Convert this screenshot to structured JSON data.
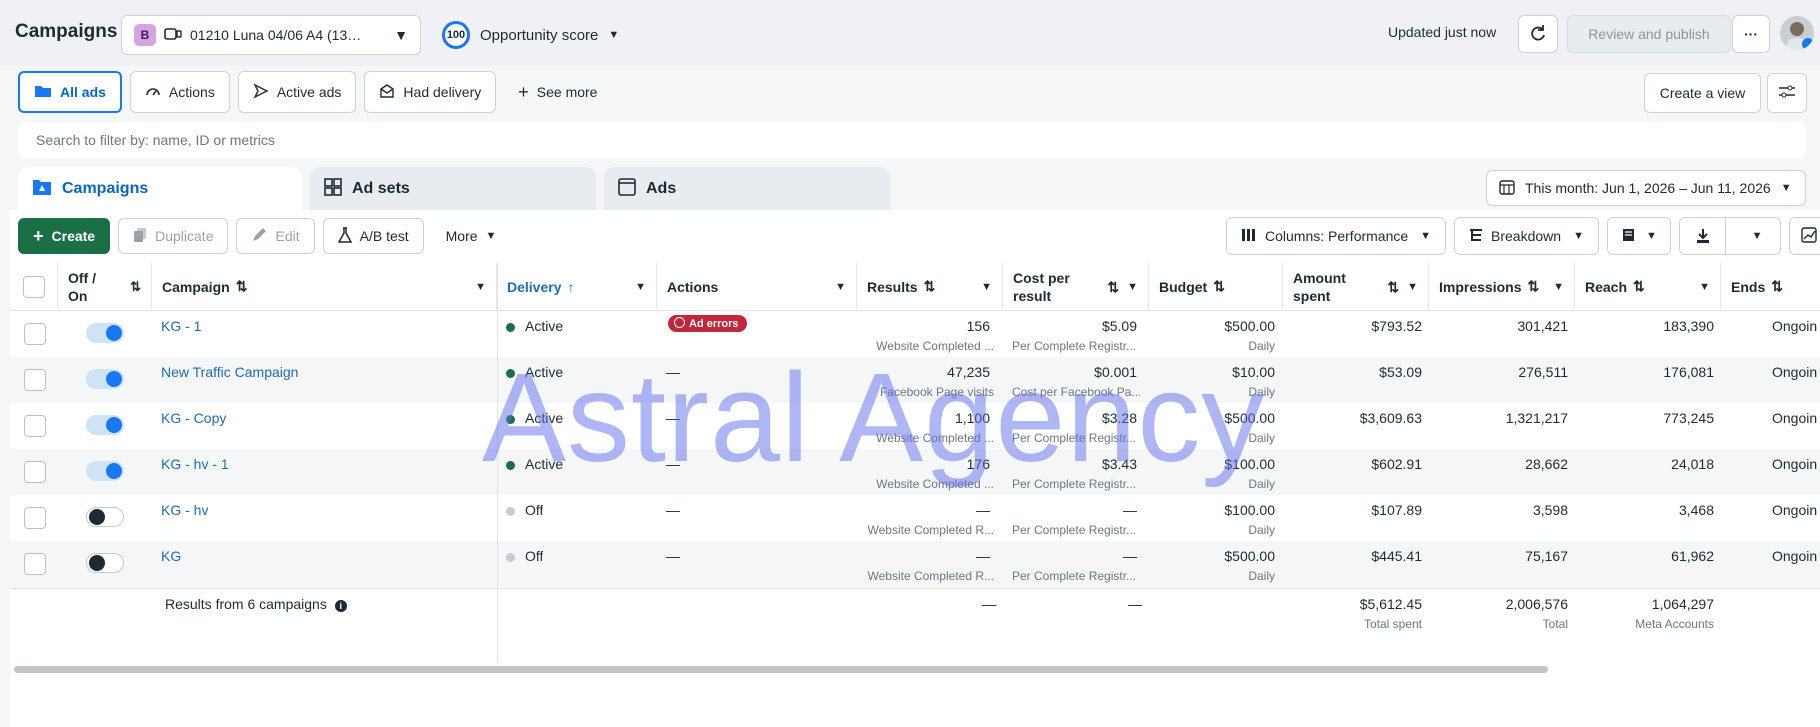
{
  "header": {
    "title": "Campaigns",
    "account_badge": "B",
    "account_name": "01210 Luna 04/06 A4 (13…",
    "score_value": "100",
    "score_label": "Opportunity score",
    "updated": "Updated just now",
    "review_label": "Review and publish",
    "more_label": "···"
  },
  "filters": {
    "items": [
      "All ads",
      "Actions",
      "Active ads",
      "Had delivery"
    ],
    "see_more": "See more",
    "create_view": "Create a view"
  },
  "search": {
    "placeholder": "Search to filter by: name, ID or metrics"
  },
  "tabs": [
    "Campaigns",
    "Ad sets",
    "Ads"
  ],
  "date_range": "This month: Jun 1, 2026 – Jun 11, 2026",
  "toolbar": {
    "create": "Create",
    "duplicate": "Duplicate",
    "edit": "Edit",
    "ab_test": "A/B test",
    "more": "More",
    "columns": "Columns: Performance",
    "breakdown": "Breakdown"
  },
  "columns": {
    "offon": "Off / On",
    "campaign": "Campaign",
    "delivery": "Delivery",
    "actions": "Actions",
    "results": "Results",
    "cost": "Cost per result",
    "budget": "Budget",
    "amount": "Amount spent",
    "impressions": "Impressions",
    "reach": "Reach",
    "ends": "Ends"
  },
  "rows": [
    {
      "name": "KG - 1",
      "on": true,
      "delivery": "Active",
      "actions": "Ad errors",
      "results": "156",
      "results_sub": "Website Completed ...",
      "cost": "$5.09",
      "cost_sub": "Per Complete Registr...",
      "budget": "$500.00",
      "budget_sub": "Daily",
      "amount": "$793.52",
      "impressions": "301,421",
      "reach": "183,390",
      "ends": "Ongoin"
    },
    {
      "name": "New Traffic Campaign",
      "on": true,
      "delivery": "Active",
      "actions": "—",
      "results": "47,235",
      "results_sub": "Facebook Page visits",
      "cost": "$0.001",
      "cost_sub": "Cost per Facebook Pa...",
      "budget": "$10.00",
      "budget_sub": "Daily",
      "amount": "$53.09",
      "impressions": "276,511",
      "reach": "176,081",
      "ends": "Ongoin"
    },
    {
      "name": "KG - Copy",
      "on": true,
      "delivery": "Active",
      "actions": "—",
      "results": "1,100",
      "results_sub": "Website Completed ...",
      "cost": "$3.28",
      "cost_sub": "Per Complete Registr...",
      "budget": "$500.00",
      "budget_sub": "Daily",
      "amount": "$3,609.63",
      "impressions": "1,321,217",
      "reach": "773,245",
      "ends": "Ongoin"
    },
    {
      "name": "KG - hv - 1",
      "on": true,
      "delivery": "Active",
      "actions": "—",
      "results": "176",
      "results_sub": "Website Completed ...",
      "cost": "$3.43",
      "cost_sub": "Per Complete Registr...",
      "budget": "$100.00",
      "budget_sub": "Daily",
      "amount": "$602.91",
      "impressions": "28,662",
      "reach": "24,018",
      "ends": "Ongoin"
    },
    {
      "name": "KG - hv",
      "on": false,
      "delivery": "Off",
      "actions": "—",
      "results": "—",
      "results_sub": "Website Completed R...",
      "cost": "—",
      "cost_sub": "Per Complete Registr...",
      "budget": "$100.00",
      "budget_sub": "Daily",
      "amount": "$107.89",
      "impressions": "3,598",
      "reach": "3,468",
      "ends": "Ongoin"
    },
    {
      "name": "KG",
      "on": false,
      "delivery": "Off",
      "actions": "—",
      "results": "—",
      "results_sub": "Website Completed R...",
      "cost": "—",
      "cost_sub": "Per Complete Registr...",
      "budget": "$500.00",
      "budget_sub": "Daily",
      "amount": "$445.41",
      "impressions": "75,167",
      "reach": "61,962",
      "ends": "Ongoin"
    }
  ],
  "totals": {
    "label": "Results from 6 campaigns",
    "results": "—",
    "cost": "—",
    "amount": "$5,612.45",
    "amount_sub": "Total spent",
    "impressions": "2,006,576",
    "impressions_sub": "Total",
    "reach": "1,064,297",
    "reach_sub": "Meta Accounts"
  },
  "watermark": "Astral Agency",
  "colors": {
    "accent": "#1877f2",
    "create": "#1b6f46",
    "active_dot": "#1b6f46",
    "error": "#c0273a"
  }
}
